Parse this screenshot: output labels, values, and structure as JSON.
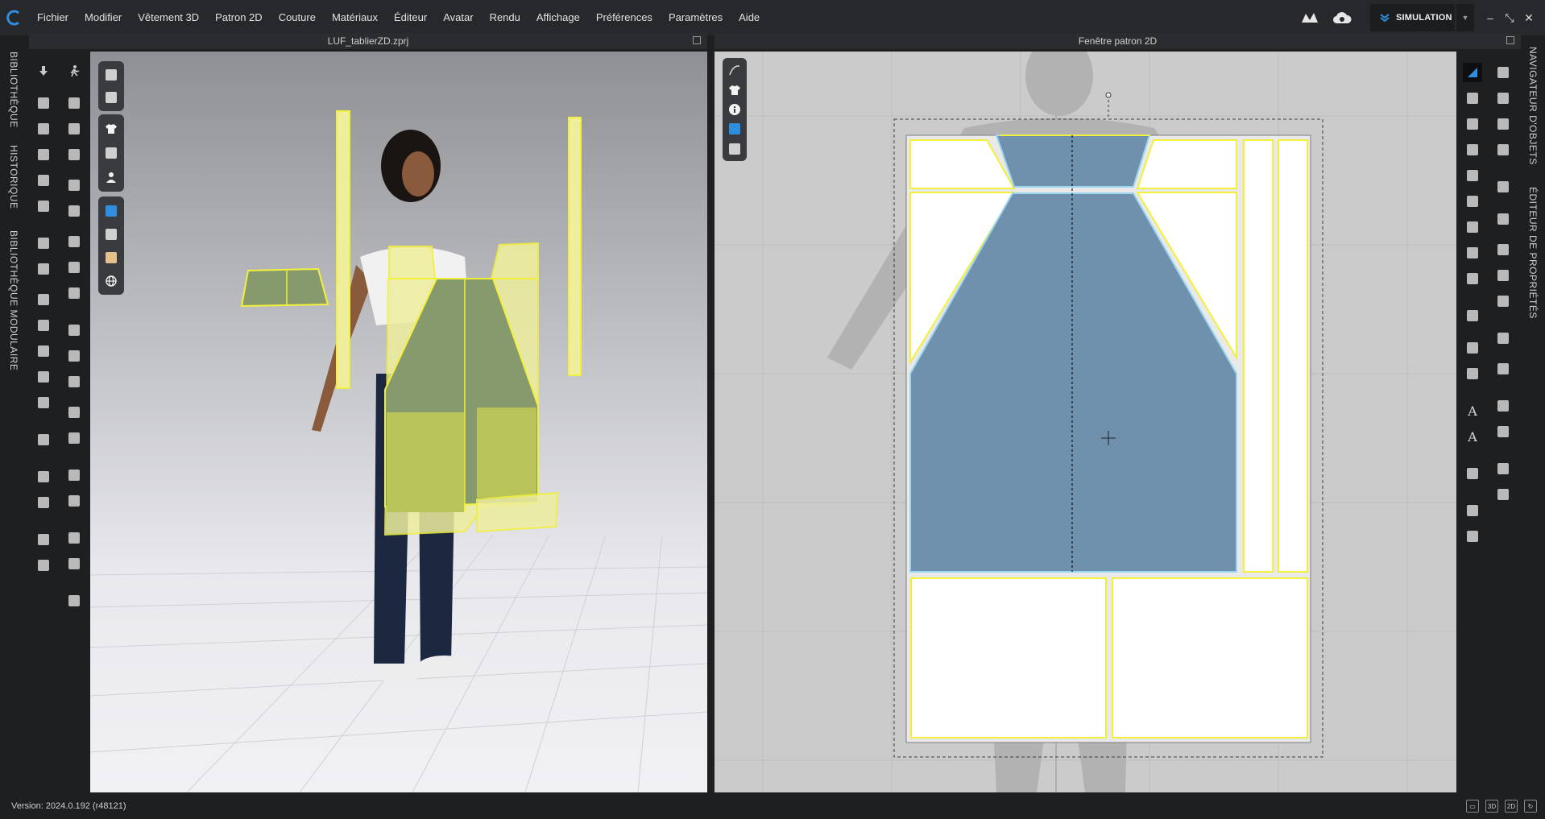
{
  "menu": [
    "Fichier",
    "Modifier",
    "Vêtement 3D",
    "Patron 2D",
    "Couture",
    "Matériaux",
    "Éditeur",
    "Avatar",
    "Rendu",
    "Affichage",
    "Préférences",
    "Paramètres",
    "Aide"
  ],
  "header": {
    "mode_label": "SIMULATION"
  },
  "left_tabs": [
    "BIBLIOTHÈQUE",
    "HISTORIQUE",
    "BIBLIOTHÈQUE MODULAIRE"
  ],
  "right_tabs": [
    "NAVIGATEUR D'OBJETS",
    "ÉDITEUR DE PROPRIÉTÉS"
  ],
  "view3d": {
    "title": "LUF_tablierZD.zprj"
  },
  "view2d": {
    "title": "Fenêtre patron 2D"
  },
  "status": {
    "version": "Version: 2024.0.192 (r48121)",
    "view_buttons": [
      "3D",
      "2D"
    ]
  },
  "colors": {
    "accent": "#2f8ee0",
    "selection_yellow": "#f2f03a",
    "pattern_blue": "#6f91ad",
    "pattern_green": "#869a6e"
  }
}
